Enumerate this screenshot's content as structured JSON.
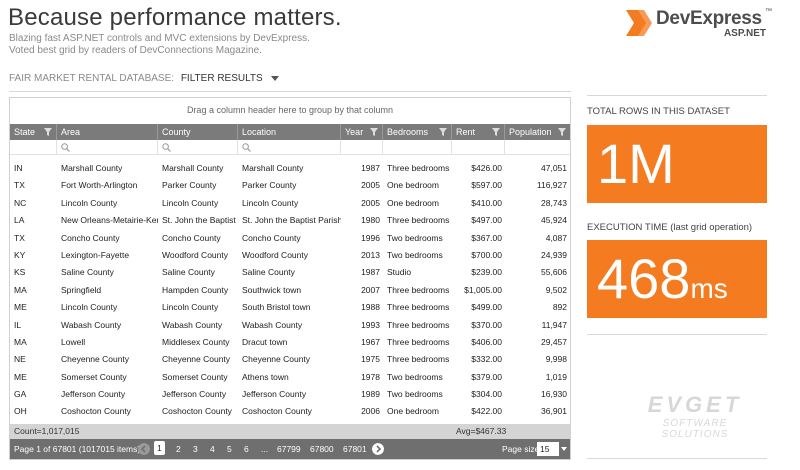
{
  "header": {
    "title": "Because performance matters.",
    "subtitle_line1": "Blazing fast ASP.NET controls and MVC extensions by DevExpress.",
    "subtitle_line2": "Voted best grid by readers of DevConnections Magazine.",
    "logo_text": "DevExpress",
    "logo_sub": "ASP.NET",
    "logo_tm": "™"
  },
  "filterbar": {
    "db_label": "FAIR MARKET RENTAL DATABASE:",
    "filter_label": "FILTER RESULTS"
  },
  "grid": {
    "group_panel": "Drag a column header here to group by that column",
    "columns": [
      "State",
      "Area",
      "County",
      "Location",
      "Year",
      "Bedrooms",
      "Rent",
      "Population"
    ],
    "rows": [
      [
        "IN",
        "Marshall County",
        "Marshall County",
        "Marshall County",
        "1987",
        "Three bedrooms",
        "$426.00",
        "47,051"
      ],
      [
        "TX",
        "Fort Worth-Arlington",
        "Parker County",
        "Parker County",
        "2005",
        "One bedroom",
        "$597.00",
        "116,927"
      ],
      [
        "NC",
        "Lincoln County",
        "Lincoln County",
        "Lincoln County",
        "2005",
        "One bedroom",
        "$410.00",
        "28,743"
      ],
      [
        "LA",
        "New Orleans-Metairie-Kenr",
        "St. John the Baptist Pa",
        "St. John the Baptist Parish",
        "1980",
        "Three bedrooms",
        "$497.00",
        "45,924"
      ],
      [
        "TX",
        "Concho County",
        "Concho County",
        "Concho County",
        "1996",
        "Two bedrooms",
        "$367.00",
        "4,087"
      ],
      [
        "KY",
        "Lexington-Fayette",
        "Woodford County",
        "Woodford County",
        "2013",
        "Two bedrooms",
        "$700.00",
        "24,939"
      ],
      [
        "KS",
        "Saline County",
        "Saline County",
        "Saline County",
        "1987",
        "Studio",
        "$239.00",
        "55,606"
      ],
      [
        "MA",
        "Springfield",
        "Hampden County",
        "Southwick town",
        "2007",
        "Three bedrooms",
        "$1,005.00",
        "9,502"
      ],
      [
        "ME",
        "Lincoln County",
        "Lincoln County",
        "South Bristol town",
        "1988",
        "Three bedrooms",
        "$499.00",
        "892"
      ],
      [
        "IL",
        "Wabash County",
        "Wabash County",
        "Wabash County",
        "1993",
        "Three bedrooms",
        "$370.00",
        "11,947"
      ],
      [
        "MA",
        "Lowell",
        "Middlesex County",
        "Dracut town",
        "1967",
        "Three bedrooms",
        "$406.00",
        "29,457"
      ],
      [
        "NE",
        "Cheyenne County",
        "Cheyenne County",
        "Cheyenne County",
        "1975",
        "Three bedrooms",
        "$332.00",
        "9,998"
      ],
      [
        "ME",
        "Somerset County",
        "Somerset County",
        "Athens town",
        "1978",
        "Two bedrooms",
        "$379.00",
        "1,019"
      ],
      [
        "GA",
        "Jefferson County",
        "Jefferson County",
        "Jefferson County",
        "1989",
        "Two bedrooms",
        "$304.00",
        "16,930"
      ],
      [
        "OH",
        "Coshocton County",
        "Coshocton County",
        "Coshocton County",
        "2006",
        "One bedroom",
        "$422.00",
        "36,901"
      ]
    ],
    "footer_count": "Count=1,017,015",
    "footer_avg": "Avg=$467.33"
  },
  "pager": {
    "info": "Page 1 of 67801 (1017015 items)",
    "pages": [
      "1",
      "2",
      "3",
      "4",
      "5",
      "6",
      "...",
      "67799",
      "67800",
      "67801"
    ],
    "current_page": "1",
    "page_size_label": "Page size",
    "page_size": "15"
  },
  "side": {
    "rows_label": "TOTAL ROWS IN THIS DATASET",
    "rows_value": "1M",
    "exec_label": "EXECUTION TIME (last grid operation)",
    "exec_value": "468",
    "exec_unit": "ms"
  },
  "watermark": {
    "line1": "EVGET",
    "line2": "SOFTWARE SOLUTIONS"
  },
  "colors": {
    "accent": "#f47b20",
    "header_gray": "#7b7b7b",
    "pager_gray": "#6f6f6f"
  }
}
